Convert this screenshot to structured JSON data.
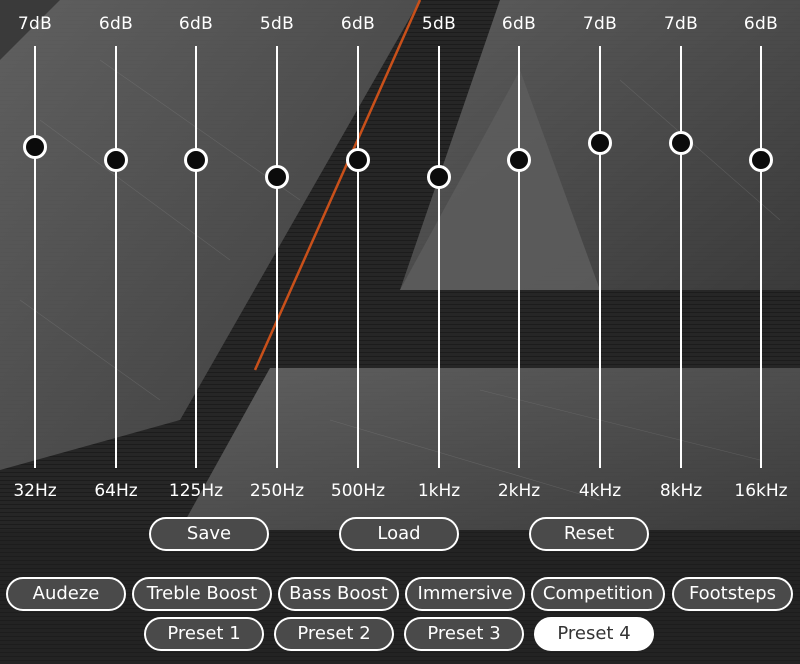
{
  "equalizer": {
    "bands": [
      {
        "gain": "7dB",
        "freq": "32Hz",
        "level": 0.76
      },
      {
        "gain": "6dB",
        "freq": "64Hz",
        "level": 0.73
      },
      {
        "gain": "6dB",
        "freq": "125Hz",
        "level": 0.73
      },
      {
        "gain": "5dB",
        "freq": "250Hz",
        "level": 0.69
      },
      {
        "gain": "6dB",
        "freq": "500Hz",
        "level": 0.73
      },
      {
        "gain": "5dB",
        "freq": "1kHz",
        "level": 0.69
      },
      {
        "gain": "6dB",
        "freq": "2kHz",
        "level": 0.73
      },
      {
        "gain": "7dB",
        "freq": "4kHz",
        "level": 0.77
      },
      {
        "gain": "7dB",
        "freq": "8kHz",
        "level": 0.77
      },
      {
        "gain": "6dB",
        "freq": "16kHz",
        "level": 0.73
      }
    ]
  },
  "actions": {
    "save": "Save",
    "load": "Load",
    "reset": "Reset"
  },
  "presets": {
    "row1": [
      "Audeze",
      "Treble Boost",
      "Bass Boost",
      "Immersive",
      "Competition",
      "Footsteps"
    ],
    "row2": [
      "Preset 1",
      "Preset 2",
      "Preset 3",
      "Preset 4"
    ],
    "active": "Preset 4"
  },
  "colors": {
    "accent_stripe": "#c8501a",
    "button_bg": "#4a4a4a",
    "button_border": "#ffffff",
    "active_bg": "#ffffff"
  }
}
